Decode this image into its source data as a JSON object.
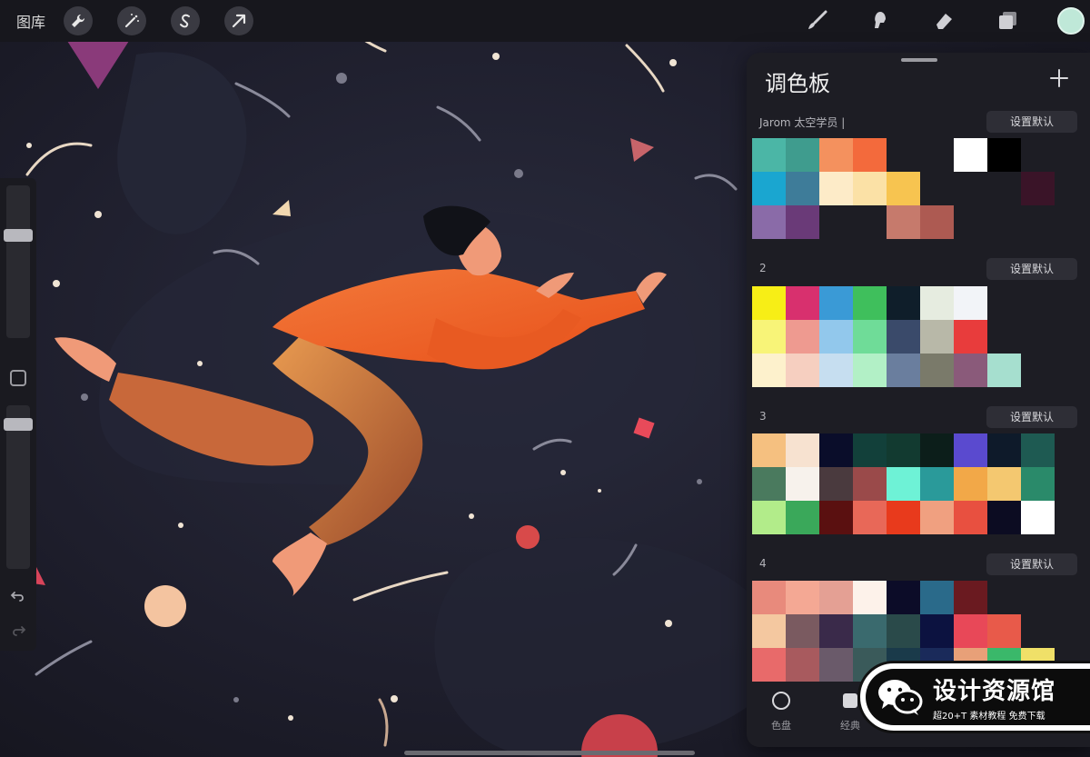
{
  "topbar": {
    "gallery_label": "图库",
    "left_tools": [
      "wrench-icon",
      "magic-wand-icon",
      "selection-s-icon",
      "transform-arrow-icon"
    ],
    "right_tools": [
      "brush-icon",
      "smudge-icon",
      "eraser-icon",
      "layers-icon"
    ],
    "current_color": "#bfe8d8"
  },
  "panel": {
    "title": "调色板",
    "palettes": [
      {
        "name": "Jarom 太空学员 |",
        "default_label": "设置默认",
        "colors": [
          "#4bb6a6",
          "#3f9c8e",
          "#f4915e",
          "#f36a3c",
          "#1d1d24",
          "#1d1d24",
          "#ffffff",
          "#000000",
          "#1d1d24",
          "#1aa6d0",
          "#3e7c99",
          "#fdebc8",
          "#fbe1a6",
          "#f7c450",
          "#1d1d24",
          "#1d1d24",
          "#1d1d24",
          "#3a1428",
          "#8a6ba8",
          "#6a3a78",
          "#1d1d24",
          "#1d1d24",
          "#c67a6c",
          "#ad5a52",
          "#1d1d24",
          "#1d1d24",
          "#1d1d24"
        ]
      },
      {
        "name": "2",
        "default_label": "设置默认",
        "colors": [
          "#f7ee16",
          "#d8306e",
          "#3a9ad6",
          "#3fbf5c",
          "#0f1e2a",
          "#e6ece0",
          "#f2f4f8",
          "#1d1d24",
          "#1d1d24",
          "#f8f478",
          "#ee9a90",
          "#92c8ec",
          "#6fdc98",
          "#3a4a6a",
          "#b8b8a8",
          "#e83c3c",
          "#1d1d24",
          "#1d1d24",
          "#fdf1cc",
          "#f6cfc0",
          "#c6def0",
          "#b2f0c6",
          "#6a7e9e",
          "#7a7a6a",
          "#8a5a7a",
          "#a6dfcf",
          "#1d1d24"
        ]
      },
      {
        "name": "3",
        "default_label": "设置默认",
        "colors": [
          "#f5c080",
          "#f7e2d0",
          "#0a0d2a",
          "#12403a",
          "#123a30",
          "#0c1e1a",
          "#5a4acf",
          "#0e1a2a",
          "#1e5a52",
          "#4a7a5e",
          "#f7f2ec",
          "#4a3a3e",
          "#9a4a4a",
          "#6ef2d6",
          "#2a9a9a",
          "#f2a848",
          "#f4c870",
          "#2a8a6a",
          "#b2ec8a",
          "#3aa85a",
          "#5a1010",
          "#e86858",
          "#e83a1c",
          "#f0a080",
          "#e85040",
          "#0c0c22",
          "#ffffff"
        ]
      },
      {
        "name": "4",
        "default_label": "设置默认",
        "colors": [
          "#e88a7c",
          "#f4a894",
          "#e4a094",
          "#fdf2ea",
          "#0c0c28",
          "#2a6a8a",
          "#6a1a20",
          "#1d1d24",
          "#1d1d24",
          "#f4c8a0",
          "#7a5a60",
          "#3a2a4a",
          "#3a6a6e",
          "#2a4a4a",
          "#0c1240",
          "#e84858",
          "#e85a4a",
          "#1d1d24",
          "#e86a6a",
          "#a85a5e",
          "#6a5a6a",
          "#3a5a5a",
          "#1a3a4a",
          "#1a2a5a",
          "#e8a078",
          "#3ab86a",
          "#f0e068"
        ]
      }
    ],
    "tabs": [
      {
        "label": "色盘",
        "icon": "disc-icon"
      },
      {
        "label": "经典",
        "icon": "square-icon"
      }
    ]
  },
  "watermark": {
    "title": "设计资源馆",
    "subtitle": "超20+T 素材教程 免费下载"
  }
}
